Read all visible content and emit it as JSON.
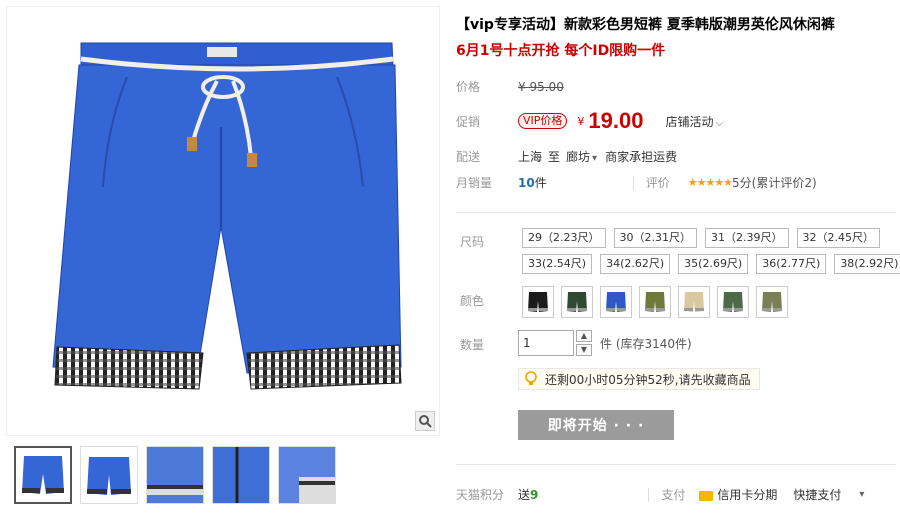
{
  "product": {
    "title": "【vip专享活动】新款彩色男短裤 夏季韩版潮男英伦风休闲裤",
    "subtitle": "6月1号十点开抢 每个ID限购一件"
  },
  "price": {
    "label": "价格",
    "currency": "¥",
    "original": "95.00",
    "promo_label": "促销",
    "vip_tag": "VIP价格",
    "vip_currency": "¥",
    "vip_price": "19.00",
    "shop_activity": "店铺活动"
  },
  "shipping": {
    "label": "配送",
    "from": "上海",
    "to_word": "至",
    "to": "廊坊",
    "fee": "商家承担运费"
  },
  "sales": {
    "label": "月销量",
    "count": "10",
    "unit": "件",
    "review_label": "评价",
    "stars": "★★★★★",
    "score": "5分(累计评价2)"
  },
  "sizes": {
    "label": "尺码",
    "row1": [
      "29（2.23尺）",
      "30（2.31尺）",
      "31（2.39尺）",
      "32（2.45尺）"
    ],
    "row2": [
      "33(2.54尺)",
      "34(2.62尺)",
      "35(2.69尺)",
      "36(2.77尺)",
      "38(2.92尺)"
    ]
  },
  "colors": {
    "label": "颜色",
    "swatches": [
      "#1b1b1b",
      "#2f4a33",
      "#2e57c7",
      "#6f7a3a",
      "#d8c9a0",
      "#4c6a48",
      "#7a7f55"
    ]
  },
  "quantity": {
    "label": "数量",
    "value": "1",
    "stock": "件 (库存3140件)"
  },
  "tip": {
    "text": "还剩00小时05分钟52秒,请先收藏商品"
  },
  "cta": {
    "label": "即将开始 · · ·"
  },
  "footer": {
    "points_label": "天猫积分",
    "points_prefix": "送",
    "points_value": "9",
    "pay_label": "支付",
    "card_installment": "信用卡分期",
    "quick_pay": "快捷支付"
  },
  "colors_ui": {
    "accent_red": "#cc0000",
    "product_blue": "#2f5fd0"
  }
}
